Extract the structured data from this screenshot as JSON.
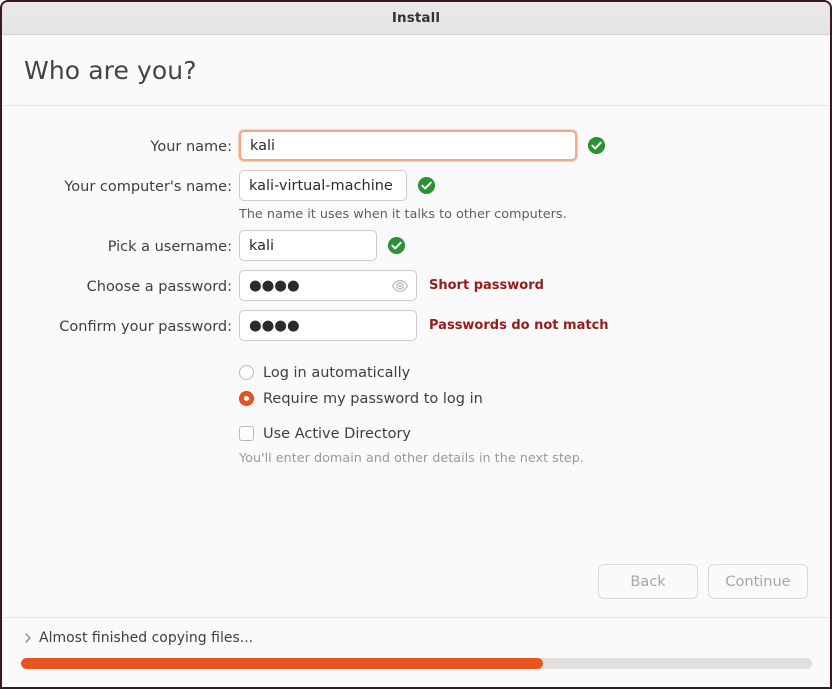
{
  "window": {
    "title": "Install",
    "border_color": "#3b1528"
  },
  "header": {
    "heading": "Who are you?"
  },
  "form": {
    "fields": [
      {
        "label": "Your name:",
        "value": "kali",
        "placeholder": "",
        "valid": true,
        "focused": true
      },
      {
        "label": "Your computer's name:",
        "value": "kali-virtual-machine",
        "placeholder": "",
        "valid": true,
        "hint": "The name it uses when it talks to other computers."
      },
      {
        "label": "Pick a username:",
        "value": "kali",
        "placeholder": "",
        "valid": true
      },
      {
        "label": "Choose a password:",
        "value": "●●●●",
        "error": "Short password",
        "reveal_icon": "eye-icon"
      },
      {
        "label": "Confirm your password:",
        "value": "●●●●",
        "error": "Passwords do not match"
      }
    ]
  },
  "options": {
    "login_auto": {
      "label": "Log in automatically",
      "selected": false
    },
    "login_password": {
      "label": "Require my password to log in",
      "selected": true
    },
    "active_directory": {
      "label": "Use Active Directory",
      "checked": false,
      "hint": "You'll enter domain and other details in the next step."
    }
  },
  "nav": {
    "back_label": "Back",
    "continue_label": "Continue",
    "back_enabled": false,
    "continue_enabled": false
  },
  "status": {
    "message": "Almost finished copying files...",
    "expander_icon": "chevron-right-icon",
    "progress_percent": 66
  },
  "colors": {
    "accent_orange": "#e8541f",
    "valid_green": "#2a9134",
    "error_red": "#961c1c",
    "focus_ring": "#f3a683"
  }
}
